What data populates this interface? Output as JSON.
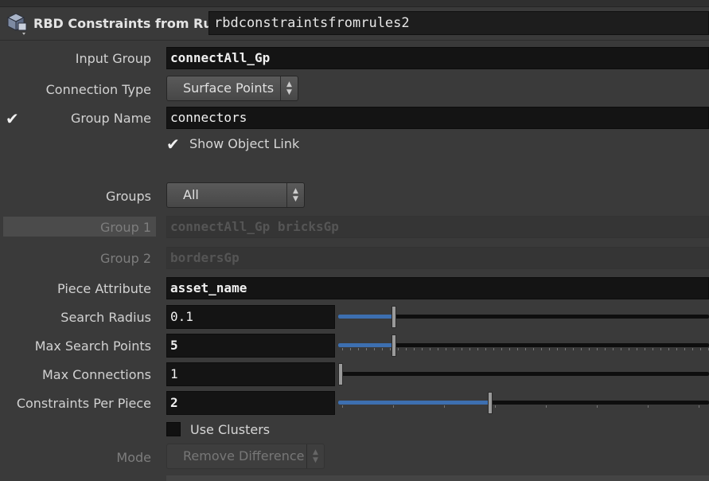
{
  "header": {
    "node_type_label": "RBD Constraints from Rules",
    "node_name": "rbdconstraintsfromrules2",
    "icon": "rbd-node-icon"
  },
  "params": {
    "input_group": {
      "label": "Input Group",
      "value": "connectAll_Gp"
    },
    "connection_type": {
      "label": "Connection Type",
      "value": "Surface Points"
    },
    "group_name": {
      "label": "Group Name",
      "value": "connectors",
      "enabled": true
    },
    "show_object_link": {
      "label": "Show Object Link",
      "checked": true
    },
    "groups": {
      "label": "Groups",
      "value": "All"
    },
    "group1": {
      "label": "Group 1",
      "value": "connectAll_Gp bricksGp"
    },
    "group2": {
      "label": "Group 2",
      "value": "bordersGp"
    },
    "piece_attribute": {
      "label": "Piece Attribute",
      "value": "asset_name"
    },
    "search_radius": {
      "label": "Search Radius",
      "value": "0.1",
      "slider_fraction": 0.15
    },
    "max_search_points": {
      "label": "Max Search Points",
      "value": "5",
      "slider_fraction": 0.15
    },
    "max_connections": {
      "label": "Max Connections",
      "value": "1",
      "slider_fraction": 0.0
    },
    "constraints_per_piece": {
      "label": "Constraints Per Piece",
      "value": "2",
      "slider_fraction": 0.41
    },
    "use_clusters": {
      "label": "Use Clusters",
      "checked": false
    },
    "mode": {
      "label": "Mode",
      "value": "Remove Difference"
    }
  },
  "colors": {
    "slider_fill": "#3d6fb0",
    "background": "#3a3a3a"
  }
}
